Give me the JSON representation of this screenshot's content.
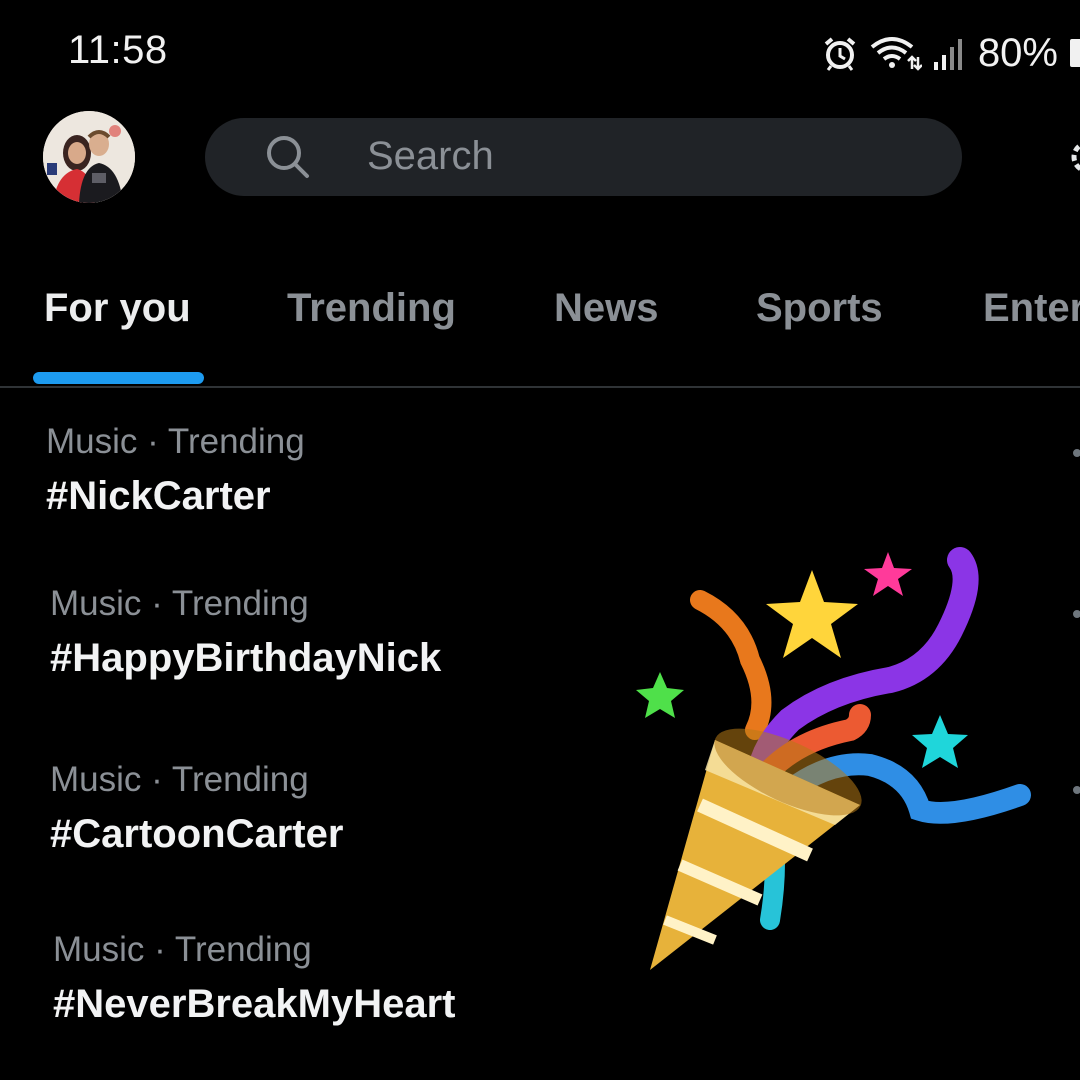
{
  "status_bar": {
    "time": "11:58",
    "battery": "80%",
    "icons": [
      "alarm-icon",
      "wifi-icon",
      "signal-icon",
      "battery-icon"
    ]
  },
  "header": {
    "search_placeholder": "Search",
    "avatar": "profile-avatar",
    "settings_icon": "gear-icon"
  },
  "tabs": [
    {
      "label": "For you",
      "active": true
    },
    {
      "label": "Trending",
      "active": false
    },
    {
      "label": "News",
      "active": false
    },
    {
      "label": "Sports",
      "active": false
    },
    {
      "label": "Enter",
      "active": false
    }
  ],
  "trends": [
    {
      "meta": "Music · Trending",
      "title": "#NickCarter"
    },
    {
      "meta": "Music · Trending",
      "title": "#HappyBirthdayNick"
    },
    {
      "meta": "Music · Trending",
      "title": "#CartoonCarter"
    },
    {
      "meta": "Music · Trending",
      "title": "#NeverBreakMyHeart"
    }
  ],
  "colors": {
    "accent": "#1d9bf0",
    "background": "#000000",
    "search_bg": "#202327",
    "secondary_text": "#8b9096"
  },
  "overlay": "party-popper-emoji"
}
